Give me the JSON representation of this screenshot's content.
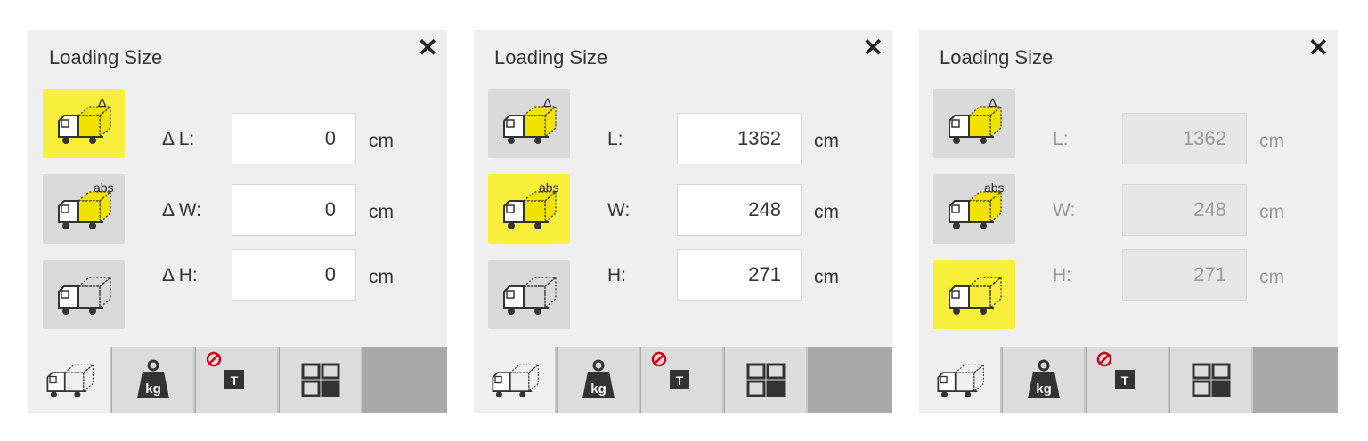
{
  "panels": [
    {
      "title": "Loading Size",
      "close_label": "✕",
      "mode_buttons": [
        {
          "badge": "Δ",
          "active": true
        },
        {
          "badge": "abs",
          "active": false
        },
        {
          "badge": "",
          "active": false
        }
      ],
      "rows": [
        {
          "label": "Δ L:",
          "value": "0",
          "unit": "cm"
        },
        {
          "label": "Δ W:",
          "value": "0",
          "unit": "cm"
        },
        {
          "label": "Δ H:",
          "value": "0",
          "unit": "cm"
        }
      ],
      "tabs": [
        {
          "icon": "truck-box-icon",
          "active": true
        },
        {
          "icon": "weight-kg-icon",
          "label": "kg",
          "active": false
        },
        {
          "icon": "no-t-icon",
          "label": "T",
          "active": false
        },
        {
          "icon": "layout-grid-icon",
          "active": false
        }
      ]
    },
    {
      "title": "Loading Size",
      "close_label": "✕",
      "mode_buttons": [
        {
          "badge": "Δ",
          "active": false
        },
        {
          "badge": "abs",
          "active": true
        },
        {
          "badge": "",
          "active": false
        }
      ],
      "rows": [
        {
          "label": "L:",
          "value": "1362",
          "unit": "cm"
        },
        {
          "label": "W:",
          "value": "248",
          "unit": "cm"
        },
        {
          "label": "H:",
          "value": "271",
          "unit": "cm"
        }
      ],
      "tabs": [
        {
          "icon": "truck-box-icon",
          "active": true
        },
        {
          "icon": "weight-kg-icon",
          "label": "kg",
          "active": false
        },
        {
          "icon": "no-t-icon",
          "label": "T",
          "active": false
        },
        {
          "icon": "layout-grid-icon",
          "active": false
        }
      ]
    },
    {
      "title": "Loading Size",
      "close_label": "✕",
      "disabled_inputs": true,
      "mode_buttons": [
        {
          "badge": "Δ",
          "active": false
        },
        {
          "badge": "abs",
          "active": false
        },
        {
          "badge": "",
          "active": true
        }
      ],
      "rows": [
        {
          "label": "L:",
          "value": "1362",
          "unit": "cm"
        },
        {
          "label": "W:",
          "value": "248",
          "unit": "cm"
        },
        {
          "label": "H:",
          "value": "271",
          "unit": "cm"
        }
      ],
      "tabs": [
        {
          "icon": "truck-box-icon",
          "active": true
        },
        {
          "icon": "weight-kg-icon",
          "label": "kg",
          "active": false
        },
        {
          "icon": "no-t-icon",
          "label": "T",
          "active": false
        },
        {
          "icon": "layout-grid-icon",
          "active": false
        }
      ]
    }
  ],
  "colors": {
    "active_mode": "#f7ef3c",
    "inactive_mode": "#d9d9d9",
    "panel_bg": "#efefef",
    "no_symbol": "#d0021b"
  }
}
